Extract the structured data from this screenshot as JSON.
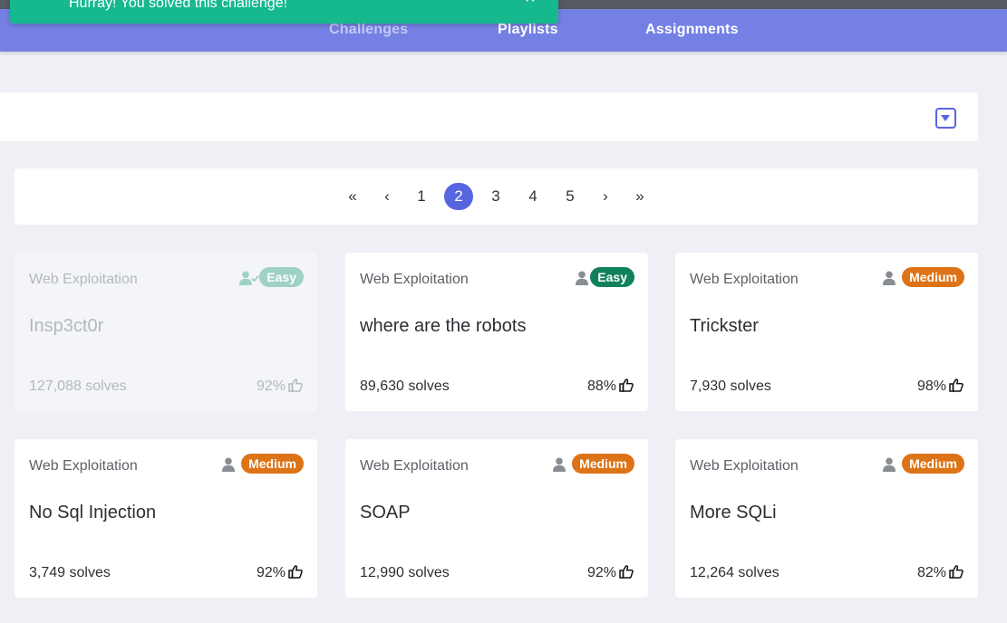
{
  "toast": {
    "message": "Hurray! You solved this challenge!",
    "close_icon": "×"
  },
  "nav": {
    "links": [
      {
        "label": "Challenges",
        "active": true
      },
      {
        "label": "Playlists"
      },
      {
        "label": "Assignments"
      }
    ]
  },
  "filter": {
    "toggle_icon": "caret-square-down-icon"
  },
  "pagination": {
    "first": "«",
    "prev": "‹",
    "pages": [
      "1",
      "2",
      "3",
      "4",
      "5"
    ],
    "current": "2",
    "next": "›",
    "last": "»"
  },
  "colors": {
    "nav": "#7480e4",
    "toast": "#16b98e",
    "accent": "#5865e0",
    "easy": "#10825a",
    "medium": "#dd7317"
  },
  "challenges": [
    {
      "category": "Web Exploitation",
      "title": "Insp3ct0r",
      "difficulty": "Easy",
      "solves": "127,088 solves",
      "rating": "92%",
      "solved": true
    },
    {
      "category": "Web Exploitation",
      "title": "where are the robots",
      "difficulty": "Easy",
      "solves": "89,630 solves",
      "rating": "88%"
    },
    {
      "category": "Web Exploitation",
      "title": "Trickster",
      "difficulty": "Medium",
      "solves": "7,930 solves",
      "rating": "98%"
    },
    {
      "category": "Web Exploitation",
      "title": "No Sql Injection",
      "difficulty": "Medium",
      "solves": "3,749 solves",
      "rating": "92%"
    },
    {
      "category": "Web Exploitation",
      "title": "SOAP",
      "difficulty": "Medium",
      "solves": "12,990 solves",
      "rating": "92%"
    },
    {
      "category": "Web Exploitation",
      "title": "More SQLi",
      "difficulty": "Medium",
      "solves": "12,264 solves",
      "rating": "82%"
    }
  ]
}
